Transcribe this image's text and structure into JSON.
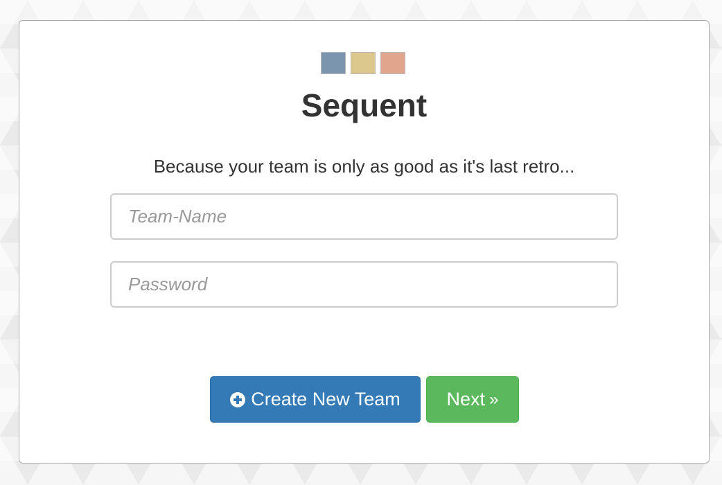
{
  "app": {
    "title": "Sequent",
    "tagline": "Because your team is only as good as it's last retro...",
    "logo_colors": [
      "#7a95ad",
      "#dcc88d",
      "#e1a48d"
    ]
  },
  "form": {
    "team_name_placeholder": "Team-Name",
    "team_name_value": "",
    "password_placeholder": "Password",
    "password_value": ""
  },
  "actions": {
    "create_label": "Create New Team",
    "create_icon": "plus-circle-icon",
    "next_label": "Next",
    "next_icon": "double-chevron-right-icon",
    "next_glyph": "»",
    "create_color": "#337ab7",
    "next_color": "#5cb85c"
  }
}
